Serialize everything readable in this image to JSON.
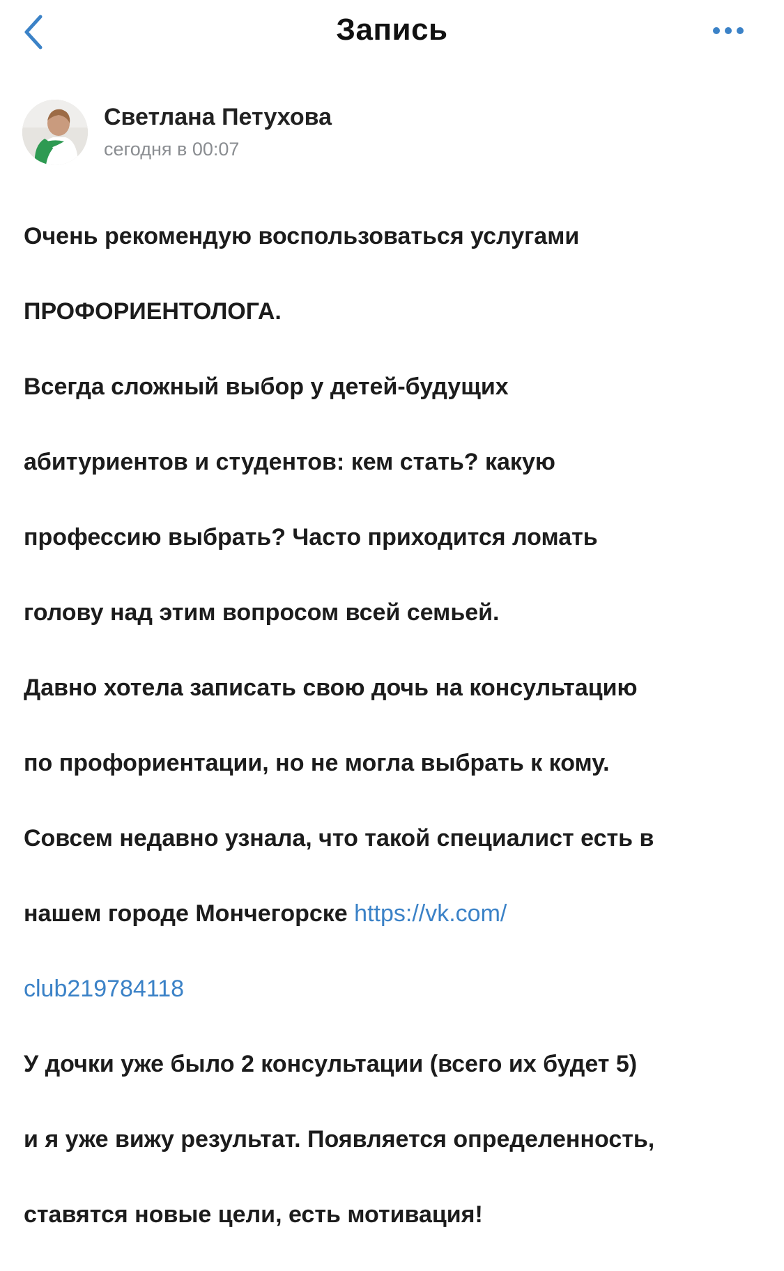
{
  "header": {
    "title": "Запись",
    "back_icon": "chevron-left-icon",
    "more_icon": "more-horizontal-icon",
    "accent_color": "#3b82c7"
  },
  "post": {
    "author_name": "Светлана Петухова",
    "time": "сегодня в 00:07",
    "lines": [
      "Очень рекомендую воспользоваться услугами",
      "ПРОФОРИЕНТОЛОГА.",
      "Всегда сложный выбор у детей-будущих",
      "абитуриентов и студентов: кем стать? какую",
      "профессию выбрать? Часто приходится ломать",
      "голову над этим вопросом всей семьей.",
      "Давно хотела записать свою дочь на консультацию",
      "по профориентации, но не могла выбрать к кому.",
      "Совсем недавно узнала, что такой специалист есть в",
      "нашем городе Мончегорске ",
      "У дочки уже было 2 консультации (всего их будет 5)",
      "и я уже вижу результат. Появляется определенность,",
      "ставятся новые цели, есть мотивация!"
    ],
    "link_part1": "https://vk.com/",
    "link_part2": "club219784118"
  }
}
